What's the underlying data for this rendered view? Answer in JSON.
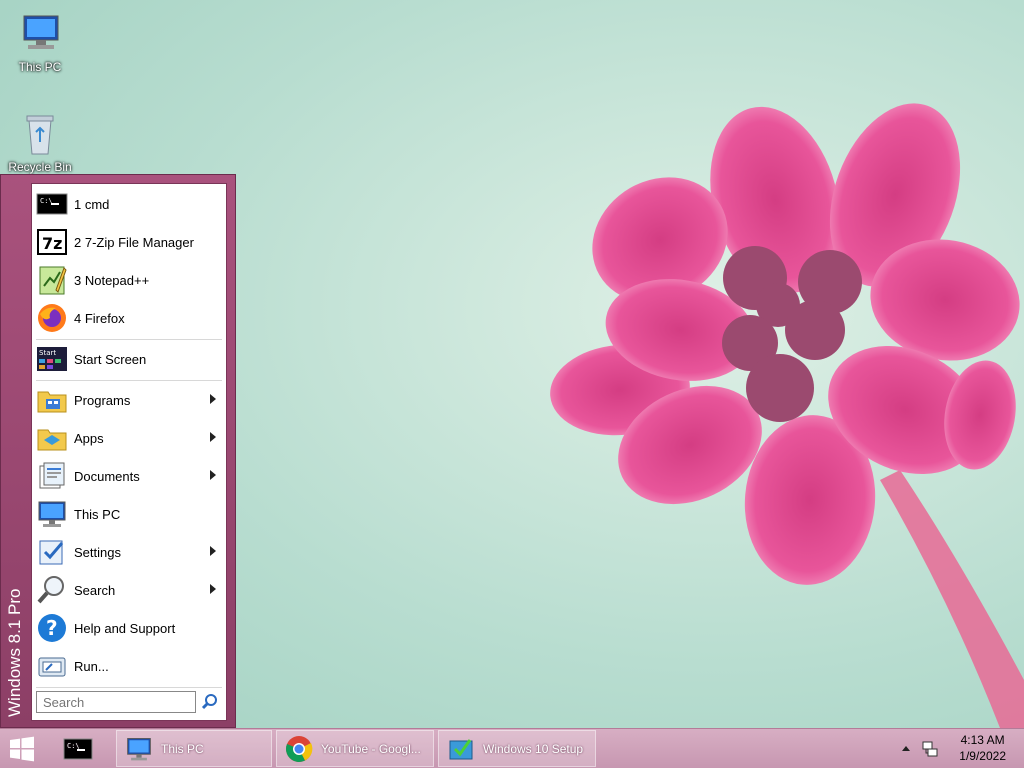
{
  "desktop": {
    "icons": [
      {
        "label": "This PC"
      },
      {
        "label": "Recycle Bin"
      }
    ]
  },
  "start_menu": {
    "side_label": "Windows 8.1 Pro",
    "recent": [
      {
        "label": "1 cmd",
        "icon": "cmd-icon"
      },
      {
        "label": "2 7-Zip File Manager",
        "icon": "7zip-icon"
      },
      {
        "label": "3 Notepad++",
        "icon": "notepadpp-icon"
      },
      {
        "label": "4 Firefox",
        "icon": "firefox-icon"
      }
    ],
    "start_screen": "Start Screen",
    "items": [
      {
        "label": "Programs",
        "icon": "programs-folder-icon",
        "submenu": true
      },
      {
        "label": "Apps",
        "icon": "apps-folder-icon",
        "submenu": true
      },
      {
        "label": "Documents",
        "icon": "documents-icon",
        "submenu": true
      },
      {
        "label": "This PC",
        "icon": "computer-icon",
        "submenu": false
      },
      {
        "label": "Settings",
        "icon": "settings-icon",
        "submenu": true
      },
      {
        "label": "Search",
        "icon": "search-icon",
        "submenu": true
      },
      {
        "label": "Help and Support",
        "icon": "help-icon",
        "submenu": false
      },
      {
        "label": "Run...",
        "icon": "run-icon",
        "submenu": false
      }
    ],
    "search_placeholder": "Search"
  },
  "taskbar": {
    "tasks": [
      {
        "label": "This PC"
      },
      {
        "label": "YouTube - Googl..."
      },
      {
        "label": "Windows 10 Setup"
      }
    ],
    "clock": {
      "time": "4:13 AM",
      "date": "1/9/2022"
    }
  },
  "colors": {
    "start_menu_accent": "#a9527d",
    "taskbar": "#d7aec3"
  }
}
